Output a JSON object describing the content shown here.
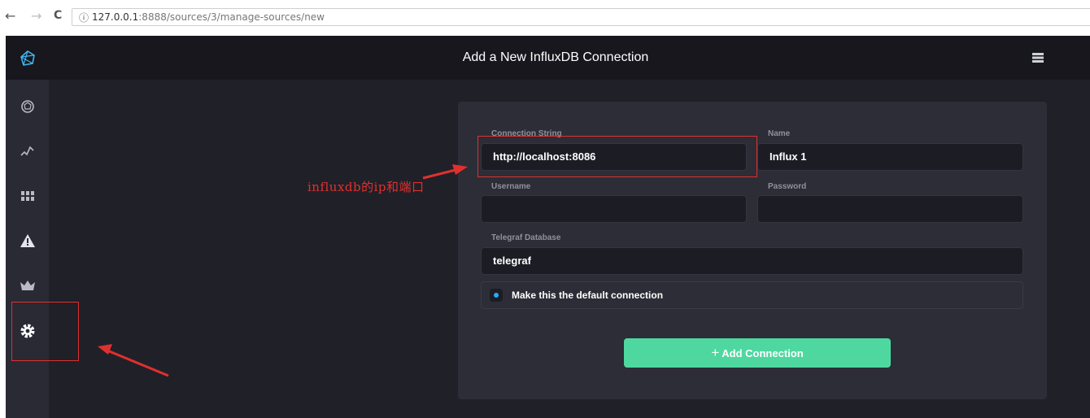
{
  "browser": {
    "back": "←",
    "forward": "→",
    "reload": "C",
    "info": "ⓘ",
    "url_host": "127.0.0.1",
    "url_rest": ":8888/sources/3/manage-sources/new"
  },
  "header": {
    "title": "Add a New InfluxDB Connection"
  },
  "sidebar": {
    "items": [
      "logo-icon",
      "dashboard-icon",
      "graph-icon",
      "grid-icon",
      "alert-icon",
      "crown-icon",
      "gear-icon"
    ],
    "active": "gear-icon"
  },
  "form": {
    "connection_label": "Connection String",
    "connection_value": "http://localhost:8086",
    "name_label": "Name",
    "name_value": "Influx 1",
    "username_label": "Username",
    "username_value": "",
    "password_label": "Password",
    "password_value": "",
    "telegraf_label": "Telegraf Database",
    "telegraf_value": "telegraf",
    "default_label": "Make this the default connection",
    "default_checked": true,
    "submit_icon": "+",
    "submit_label": "Add Connection"
  },
  "annotation": {
    "note": "influxdb的ip和端口"
  },
  "colors": {
    "accent": "#4ed8a0",
    "checkbox": "#22adf6",
    "annotation": "#e0302e",
    "sidebar": "#292a33",
    "header": "#17171d"
  }
}
